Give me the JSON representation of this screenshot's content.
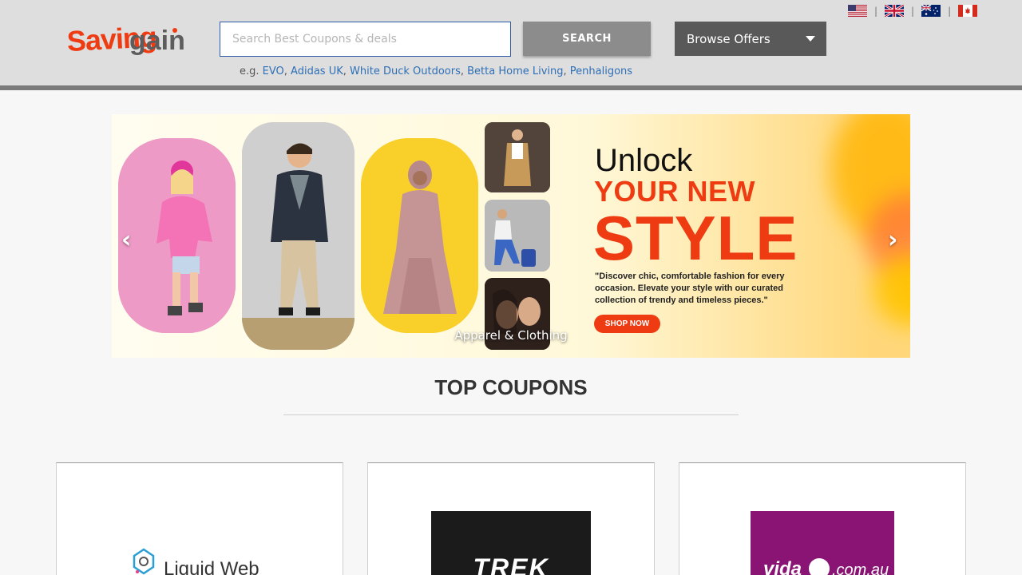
{
  "header": {
    "logo_text_1": "Saving",
    "logo_text_2": "gain",
    "search_placeholder": "Search Best Coupons & deals",
    "search_button": "SEARCH",
    "browse_label": "Browse Offers",
    "examples_prefix": "e.g.",
    "examples": [
      "EVO",
      "Adidas UK",
      "White Duck Outdoors",
      "Betta Home Living",
      "Penhaligons"
    ],
    "flags": [
      "us-flag",
      "uk-flag",
      "au-flag",
      "ca-flag"
    ]
  },
  "banner": {
    "headline_1": "Unlock",
    "headline_2": "YOUR NEW",
    "headline_3": "STYLE",
    "tagline": "\"Discover chic, comfortable fashion for every occasion. Elevate your style with our curated collection of trendy and timeless pieces.\"",
    "cta": "SHOP NOW",
    "caption": "Apparel & Clothing",
    "prev": "‹",
    "next": "›"
  },
  "top_coupons": {
    "title": "TOP COUPONS",
    "cards": [
      {
        "brand": "Liquid Web"
      },
      {
        "brand": "TREK"
      },
      {
        "brand": "vida",
        "brand_suffix": ".com.au"
      }
    ]
  },
  "colors": {
    "accent_orange": "#ef3b12",
    "link_blue": "#2e6fb6",
    "header_bg": "#dedede",
    "vida_purple": "#8a1474"
  }
}
